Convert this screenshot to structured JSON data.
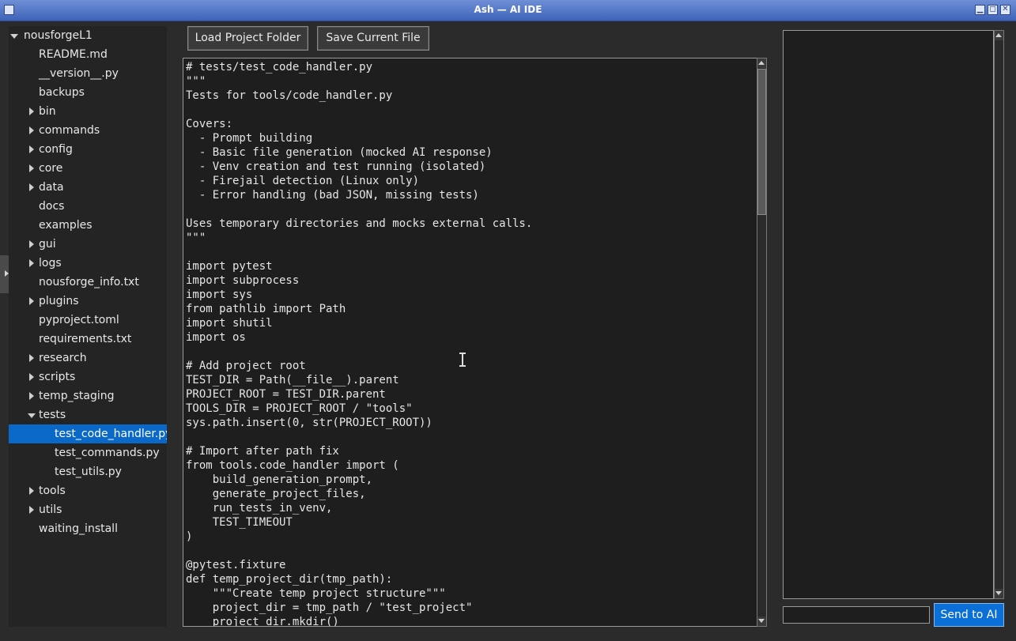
{
  "window": {
    "title": "Ash — AI IDE"
  },
  "toolbar": {
    "load_label": "Load Project Folder",
    "save_label": "Save Current File"
  },
  "tree": {
    "root": "nousforgeL1",
    "items": [
      {
        "label": "README.md",
        "type": "file",
        "depth": 1
      },
      {
        "label": "__version__.py",
        "type": "file",
        "depth": 1
      },
      {
        "label": "backups",
        "type": "file",
        "depth": 1
      },
      {
        "label": "bin",
        "type": "folder",
        "depth": 1
      },
      {
        "label": "commands",
        "type": "folder",
        "depth": 1
      },
      {
        "label": "config",
        "type": "folder",
        "depth": 1
      },
      {
        "label": "core",
        "type": "folder",
        "depth": 1
      },
      {
        "label": "data",
        "type": "folder",
        "depth": 1
      },
      {
        "label": "docs",
        "type": "file",
        "depth": 1
      },
      {
        "label": "examples",
        "type": "file",
        "depth": 1
      },
      {
        "label": "gui",
        "type": "folder",
        "depth": 1
      },
      {
        "label": "logs",
        "type": "folder",
        "depth": 1
      },
      {
        "label": "nousforge_info.txt",
        "type": "file",
        "depth": 1
      },
      {
        "label": "plugins",
        "type": "folder",
        "depth": 1
      },
      {
        "label": "pyproject.toml",
        "type": "file",
        "depth": 1
      },
      {
        "label": "requirements.txt",
        "type": "file",
        "depth": 1
      },
      {
        "label": "research",
        "type": "folder",
        "depth": 1
      },
      {
        "label": "scripts",
        "type": "folder",
        "depth": 1
      },
      {
        "label": "temp_staging",
        "type": "folder",
        "depth": 1
      },
      {
        "label": "tests",
        "type": "folder-open",
        "depth": 1
      },
      {
        "label": "test_code_handler.py",
        "type": "file",
        "depth": 2,
        "selected": true
      },
      {
        "label": "test_commands.py",
        "type": "file",
        "depth": 2
      },
      {
        "label": "test_utils.py",
        "type": "file",
        "depth": 2
      },
      {
        "label": "tools",
        "type": "folder",
        "depth": 1
      },
      {
        "label": "utils",
        "type": "folder",
        "depth": 1
      },
      {
        "label": "waiting_install",
        "type": "file",
        "depth": 1
      }
    ]
  },
  "editor": {
    "lines": [
      "# tests/test_code_handler.py",
      "\"\"\"",
      "Tests for tools/code_handler.py",
      "",
      "Covers:",
      "  - Prompt building",
      "  - Basic file generation (mocked AI response)",
      "  - Venv creation and test running (isolated)",
      "  - Firejail detection (Linux only)",
      "  - Error handling (bad JSON, missing tests)",
      "",
      "Uses temporary directories and mocks external calls.",
      "\"\"\"",
      "",
      "import pytest",
      "import subprocess",
      "import sys",
      "from pathlib import Path",
      "import shutil",
      "import os",
      "",
      "# Add project root",
      "TEST_DIR = Path(__file__).parent",
      "PROJECT_ROOT = TEST_DIR.parent",
      "TOOLS_DIR = PROJECT_ROOT / \"tools\"",
      "sys.path.insert(0, str(PROJECT_ROOT))",
      "",
      "# Import after path fix",
      "from tools.code_handler import (",
      "    build_generation_prompt,",
      "    generate_project_files,",
      "    run_tests_in_venv,",
      "    TEST_TIMEOUT",
      ")",
      "",
      "@pytest.fixture",
      "def temp_project_dir(tmp_path):",
      "    \"\"\"Create temp project structure\"\"\"",
      "    project_dir = tmp_path / \"test_project\"",
      "    project_dir.mkdir()"
    ]
  },
  "chat": {
    "input_value": "",
    "send_label": "Send to AI"
  },
  "colors": {
    "selection": "#0a68c8",
    "send_button": "#0a6fd6",
    "titlebar": "#3e63b8"
  }
}
